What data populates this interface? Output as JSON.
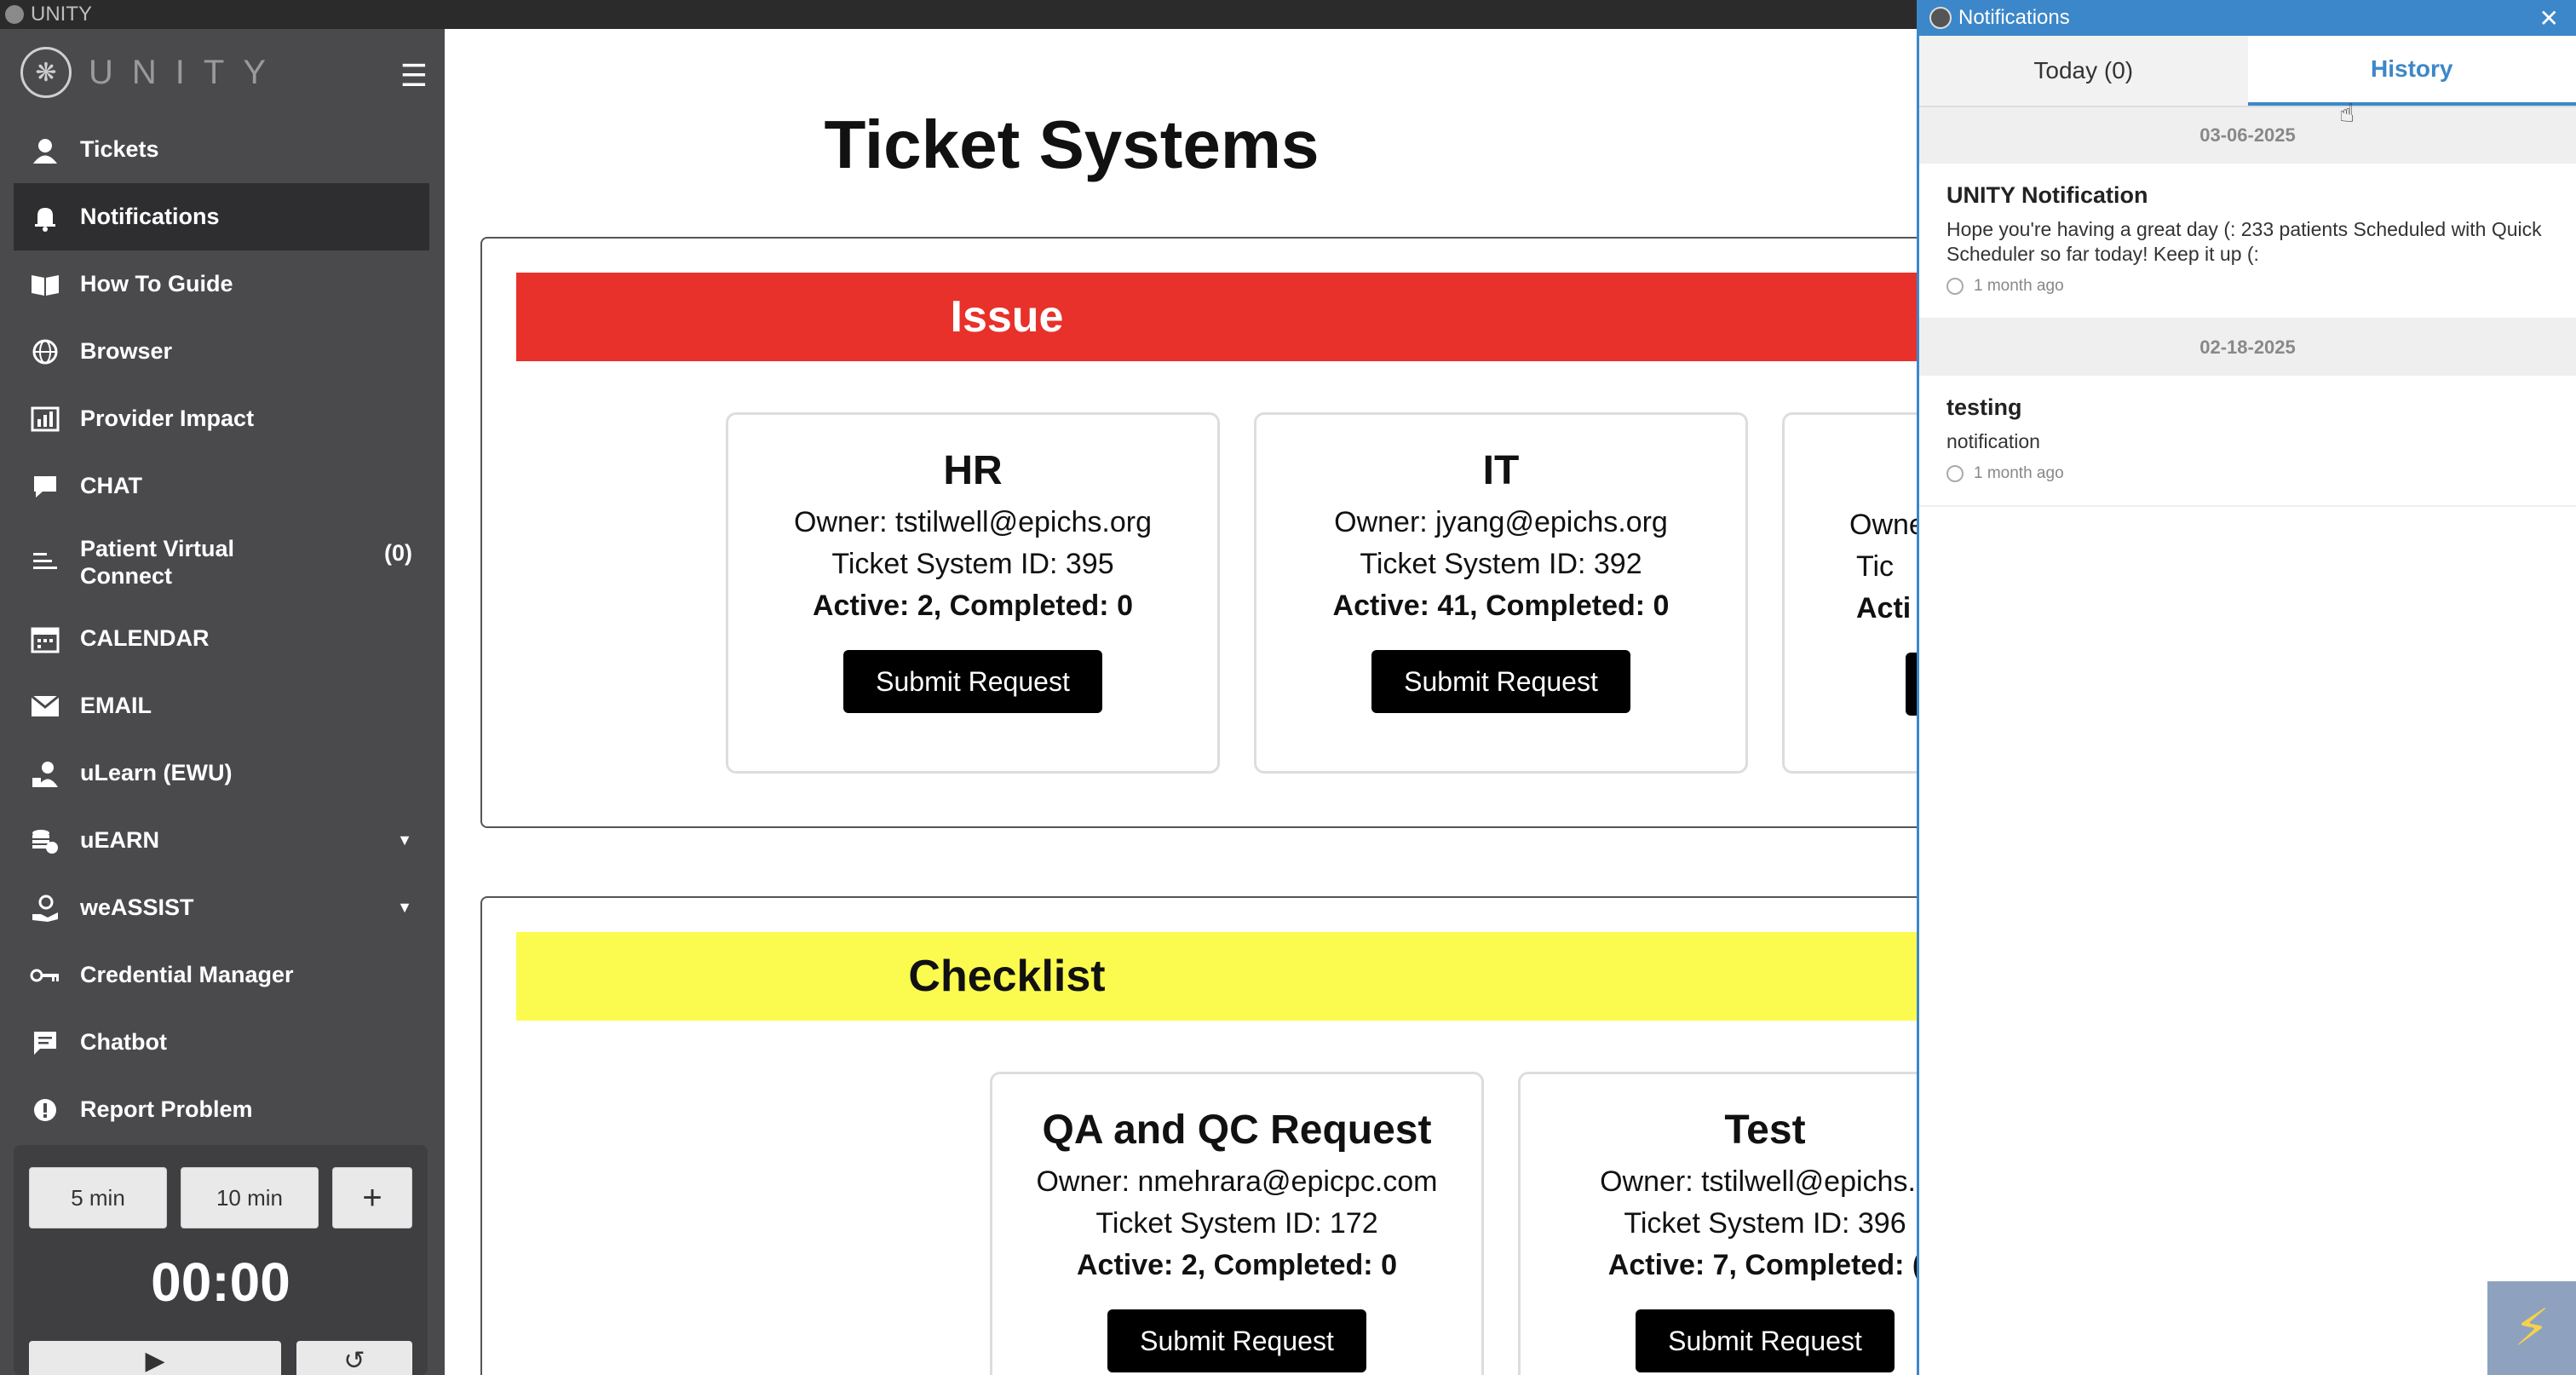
{
  "window": {
    "title": "UNITY"
  },
  "sidebar": {
    "brand": "UNITY",
    "items": [
      {
        "label": "Tickets",
        "icon": "headset-icon"
      },
      {
        "label": "Notifications",
        "icon": "bell-icon"
      },
      {
        "label": "How To Guide",
        "icon": "book-icon"
      },
      {
        "label": "Browser",
        "icon": "globe-icon"
      },
      {
        "label": "Provider Impact",
        "icon": "chart-icon"
      },
      {
        "label": "CHAT",
        "icon": "chat-icon"
      },
      {
        "label": "Patient Virtual Connect",
        "count": "(0)",
        "icon": "virtual-connect-icon"
      },
      {
        "label": "CALENDAR",
        "icon": "calendar-icon"
      },
      {
        "label": "EMAIL",
        "icon": "mail-icon"
      },
      {
        "label": "uLearn (EWU)",
        "icon": "learn-icon"
      },
      {
        "label": "uEARN",
        "icon": "coins-icon"
      },
      {
        "label": "weASSIST",
        "icon": "assist-icon"
      },
      {
        "label": "Credential Manager",
        "icon": "key-icon"
      },
      {
        "label": "Chatbot",
        "icon": "chatbot-icon"
      },
      {
        "label": "Report Problem",
        "icon": "alert-icon"
      }
    ],
    "timer": {
      "preset1": "5 min",
      "preset2": "10 min",
      "add": "+",
      "display": "00:00"
    }
  },
  "main": {
    "title": "Ticket Systems",
    "sections": [
      {
        "label": "Issue",
        "color": "#e8312a",
        "cards": [
          {
            "name": "HR",
            "owner": "Owner: tstilwell@epichs.org",
            "system_id": "Ticket System ID: 395",
            "stats": "Active: 2, Completed: 0",
            "button": "Submit Request"
          },
          {
            "name": "IT",
            "owner": "Owner: jyang@epichs.org",
            "system_id": "Ticket System ID: 392",
            "stats": "Active: 41, Completed: 0",
            "button": "Submit Request"
          },
          {
            "owner": "Owne",
            "system_id": "Tic",
            "stats": "Acti"
          }
        ]
      },
      {
        "label": "Checklist",
        "color": "#fbfb4f",
        "cards": [
          {
            "name": "QA and QC Request",
            "owner": "Owner: nmehrara@epicpc.com",
            "system_id": "Ticket System ID: 172",
            "stats": "Active: 2, Completed: 0",
            "button": "Submit Request"
          },
          {
            "name": "Test",
            "owner": "Owner: tstilwell@epichs.c",
            "system_id": "Ticket System ID: 396",
            "stats": "Active: 7, Completed: (",
            "button": "Submit Request"
          }
        ]
      }
    ]
  },
  "notifications": {
    "title": "Notifications",
    "tabs": [
      {
        "label": "Today (0)"
      },
      {
        "label": "History"
      }
    ],
    "groups": [
      {
        "date": "03-06-2025",
        "items": [
          {
            "title": "UNITY Notification",
            "body": "Hope you're having a great day (: 233 patients Scheduled with Quick Scheduler so far today! Keep it up (:",
            "time": "1 month ago"
          }
        ]
      },
      {
        "date": "02-18-2025",
        "items": [
          {
            "title": "testing",
            "body": "notification",
            "time": "1 month ago"
          }
        ]
      }
    ]
  }
}
